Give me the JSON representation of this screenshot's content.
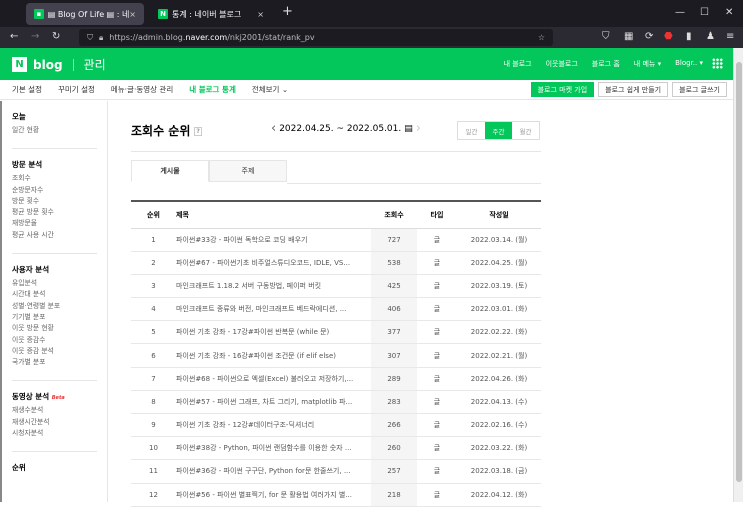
{
  "browser": {
    "tabs": [
      {
        "title": "▤ Blog Of Life ▤ : 네이버 블로그",
        "active": true
      },
      {
        "title": "통계 : 네이버 블로그",
        "active": false
      }
    ],
    "url_prefix": "https://admin.blog.",
    "url_domain": "naver.com",
    "url_path": "/nkj2001/stat/rank_pv"
  },
  "header": {
    "logo_n": "N",
    "logo_blog": "blog",
    "logo_manage": "관리",
    "links": [
      "내 블로그",
      "이웃블로그",
      "블로그 홈",
      "내 메뉴 ▾",
      "Blogr.. ▾"
    ]
  },
  "subnav": {
    "items": [
      "기본 설정",
      "꾸미기 설정",
      "메뉴·글·동영상 관리",
      "내 블로그 통계",
      "전체보기 ⌄"
    ],
    "buttons": [
      "블로그 마켓 가입",
      "블로그 쉽게 만들기",
      "블로그 글쓰기"
    ]
  },
  "sidebar": [
    {
      "title": "오늘",
      "items": [
        "일간 현황"
      ]
    },
    {
      "title": "방문 분석",
      "items": [
        "조회수",
        "순방문자수",
        "방문 횟수",
        "평균 방문 횟수",
        "재방문율",
        "평균 사용 시간"
      ]
    },
    {
      "title": "사용자 분석",
      "items": [
        "유입분석",
        "시간대 분석",
        "성별·연령별 분포",
        "기기별 분포",
        "이웃 방문 현황",
        "이웃 증감수",
        "이웃 증감 분석",
        "국가별 분포"
      ]
    },
    {
      "title": "동영상 분석",
      "badge": "Beta",
      "items": [
        "재생수분석",
        "재생시간분석",
        "시청자분석"
      ]
    },
    {
      "title": "순위",
      "items": []
    }
  ],
  "main": {
    "title": "조회수 순위",
    "help": "?",
    "date_range": "2022.04.25. ~ 2022.05.01.",
    "period": [
      "일간",
      "주간",
      "월간"
    ],
    "period_selected": "주간",
    "tabs": [
      "게시물",
      "주제"
    ],
    "columns": [
      "순위",
      "제목",
      "조회수",
      "타입",
      "작성일"
    ],
    "rows": [
      [
        "1",
        "파이썬#33강 - 파이썬 독학으로 코딩 배우기",
        "727",
        "글",
        "2022.03.14. (월)"
      ],
      [
        "2",
        "파이썬#67 - 파이썬기초 비주얼스튜디오코드, IDLE, VS...",
        "538",
        "글",
        "2022.04.25. (월)"
      ],
      [
        "3",
        "마인크래프트 1.18.2 서버 구동방법, 페이퍼 버킷",
        "425",
        "글",
        "2022.03.19. (토)"
      ],
      [
        "4",
        "마인크래프트 종류와 버전, 마인크래프트 베드락에디션, ...",
        "406",
        "글",
        "2022.03.01. (화)"
      ],
      [
        "5",
        "파이썬 기초 강좌 - 17강#파이썬 반복문 (while 문)",
        "377",
        "글",
        "2022.02.22. (화)"
      ],
      [
        "6",
        "파이썬 기초 강좌 - 16강#파이썬 조건문 (if elif else)",
        "307",
        "글",
        "2022.02.21. (월)"
      ],
      [
        "7",
        "파이썬#68 - 파이썬으로 엑셀(Excel) 불러오고 저장하기,...",
        "289",
        "글",
        "2022.04.26. (화)"
      ],
      [
        "8",
        "파이썬#57 - 파이썬 그래프, 차트 그리기, matplotlib 파...",
        "283",
        "글",
        "2022.04.13. (수)"
      ],
      [
        "9",
        "파이썬 기초 강좌 - 12강#데이터구조-딕셔너리",
        "266",
        "글",
        "2022.02.16. (수)"
      ],
      [
        "10",
        "파이썬#38강 - Python, 파이썬 랜덤함수를 이용한 숫자 ...",
        "260",
        "글",
        "2022.03.22. (화)"
      ],
      [
        "11",
        "파이썬#36강 - 파이썬 구구단, Python for문 한줄쓰기, ...",
        "257",
        "글",
        "2022.03.18. (금)"
      ],
      [
        "12",
        "파이썬#56 - 파이썬 별표찍기, for 문 활용법 여러가지 별...",
        "218",
        "글",
        "2022.04.12. (화)"
      ]
    ]
  },
  "colors": {
    "brand": "#03c75a"
  }
}
